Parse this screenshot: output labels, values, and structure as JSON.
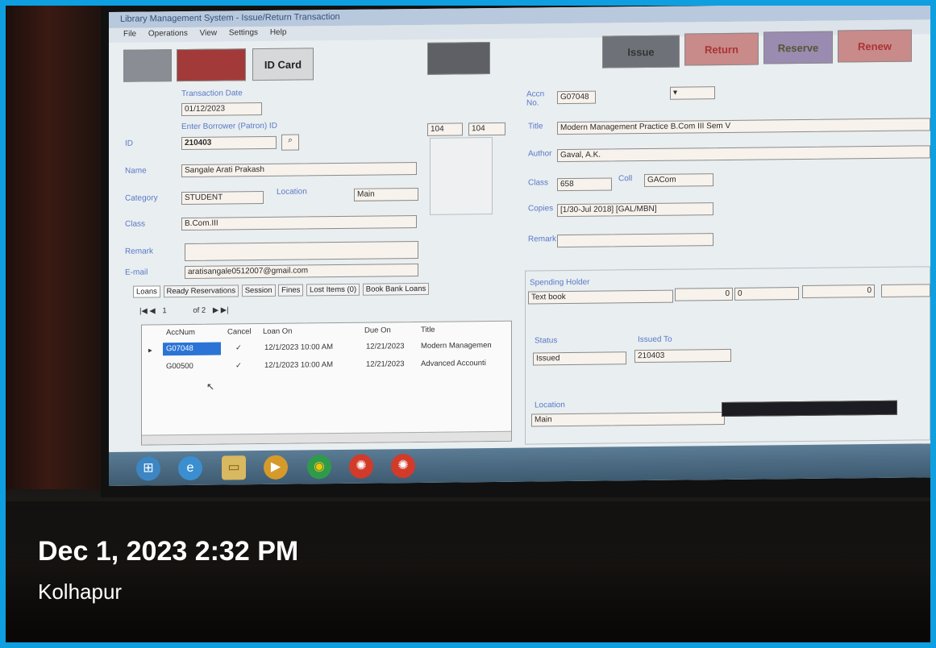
{
  "window": {
    "title": "Library Management System - Issue/Return Transaction"
  },
  "menu": [
    "File",
    "Operations",
    "View",
    "Settings",
    "Help"
  ],
  "toolbar": {
    "btn1": "",
    "btn2": "",
    "id_card": "ID Card",
    "btn_mid": "",
    "issue": "Issue",
    "return": "Return",
    "reserve": "Reserve",
    "renew": "Renew"
  },
  "member": {
    "transaction_date_label": "Transaction Date",
    "transaction_date": "01/12/2023",
    "patron_label": "Enter Borrower (Patron) ID",
    "id_label": "ID",
    "id_value": "210403",
    "name_label": "Name",
    "name": "Sangale Arati Prakash",
    "category_label": "Category",
    "category": "STUDENT",
    "location_label": "Location",
    "location": "Main",
    "class_label": "Class",
    "class": "B.Com.III",
    "remark_label": "Remark",
    "remark": "",
    "email_label": "E-mail",
    "email": "aratisangale0512007@gmail.com",
    "count1": "104",
    "count2": "104"
  },
  "book": {
    "accn_label": "Accn No.",
    "accn": "G07048",
    "title_label": "Title",
    "title": "Modern Management Practice B.Com III Sem V",
    "author_label": "Author",
    "author": "Gaval, A.K.",
    "class_label": "Class",
    "class": "658",
    "coll_label": "Coll",
    "coll": "GACom",
    "copies_label": "Copies",
    "copies": "[1/30-Jul 2018] [GAL/MBN]",
    "remark_label": "Remark",
    "remark": "",
    "spending_label": "Spending Holder",
    "spending": "Text book",
    "status_label": "Status",
    "status": "Issued",
    "issued_to_label": "Issued To",
    "issued_to": "210403",
    "location_label": "Location",
    "location": "Main"
  },
  "tabs": [
    "Loans",
    "Ready Reservations",
    "Session",
    "Fines",
    "Lost Items (0)",
    "Book Bank Loans"
  ],
  "pager": {
    "prev": "|◀  ◀",
    "page": "1",
    "of": "of 2",
    "next": "▶  ▶|"
  },
  "grid": {
    "headers": [
      "AccNum",
      "Cancel",
      "Loan On",
      "Due On",
      "Title"
    ],
    "rows": [
      {
        "accnum": "G07048",
        "cancel": "✓",
        "loan_on": "12/1/2023 10:00 AM",
        "due_on": "12/21/2023",
        "title": "Modern Managemen"
      },
      {
        "accnum": "G00500",
        "cancel": "✓",
        "loan_on": "12/1/2023 10:00 AM",
        "due_on": "12/21/2023",
        "title": "Advanced Accounti"
      }
    ]
  },
  "notification": "Notification toast",
  "caption": {
    "date": "Dec 1, 2023 2:32 PM",
    "location": "Kolhapur"
  },
  "colors": {
    "frame": "#0e9fe0",
    "label": "#5a78c8",
    "issue_btn": "#6e7278",
    "return_btn": "#c98a8a",
    "reserve_btn": "#9a8bb0"
  }
}
